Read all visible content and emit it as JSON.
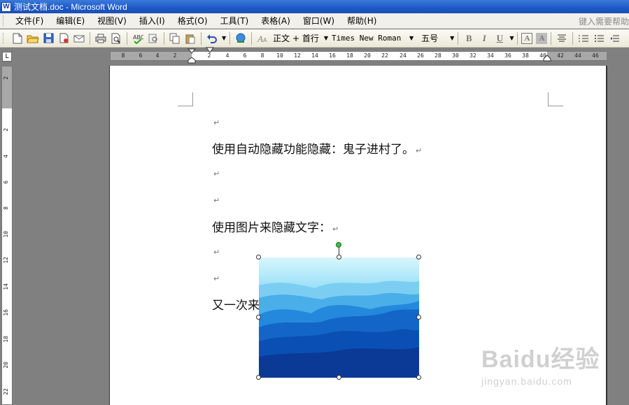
{
  "window": {
    "title": "测试文档.doc - Microsoft Word",
    "icon": "word-doc-icon"
  },
  "menu": {
    "items": [
      "文件(F)",
      "编辑(E)",
      "视图(V)",
      "插入(I)",
      "格式(O)",
      "工具(T)",
      "表格(A)",
      "窗口(W)",
      "帮助(H)"
    ],
    "help_placeholder": "键入需要帮助"
  },
  "toolbar": {
    "icons": [
      "new-doc-icon",
      "open-folder-icon",
      "save-icon",
      "permission-icon",
      "email-icon",
      "print-icon",
      "print-preview-icon",
      "spelling-icon",
      "research-icon",
      "copy-icon",
      "paste-icon",
      "undo-icon",
      "hyperlink-icon"
    ],
    "style_value": "正文 + 首行",
    "font_value": "Times New Roman",
    "size_value": "五号",
    "format_buttons": [
      "B",
      "I",
      "U",
      "A",
      "A"
    ]
  },
  "ruler": {
    "corner": "L",
    "h_numbers": [
      "8",
      "6",
      "4",
      "2",
      "2",
      "4",
      "6",
      "8",
      "10",
      "12",
      "14",
      "16",
      "18",
      "20",
      "22",
      "24",
      "26",
      "28",
      "30",
      "32",
      "34",
      "36",
      "38",
      "40",
      "42",
      "44",
      "46"
    ],
    "v_numbers": [
      "2",
      "2",
      "4",
      "6",
      "8",
      "10",
      "12",
      "14",
      "16",
      "18",
      "20",
      "22"
    ]
  },
  "document": {
    "paragraphs": [
      "",
      "使用自动隐藏功能隐藏：鬼子进村了。",
      "",
      "",
      "使用图片来隐藏文字：",
      "",
      "",
      "又一次来"
    ],
    "para_mark": "↵"
  },
  "picture": {
    "name": "blue-mountains-image",
    "colors": [
      "#b8ecfb",
      "#5cc4ef",
      "#1f7ed8",
      "#0a48b8",
      "#0a2f8a"
    ]
  },
  "watermark": {
    "brand": "Baidu经验",
    "url": "jingyan.baidu.com"
  }
}
